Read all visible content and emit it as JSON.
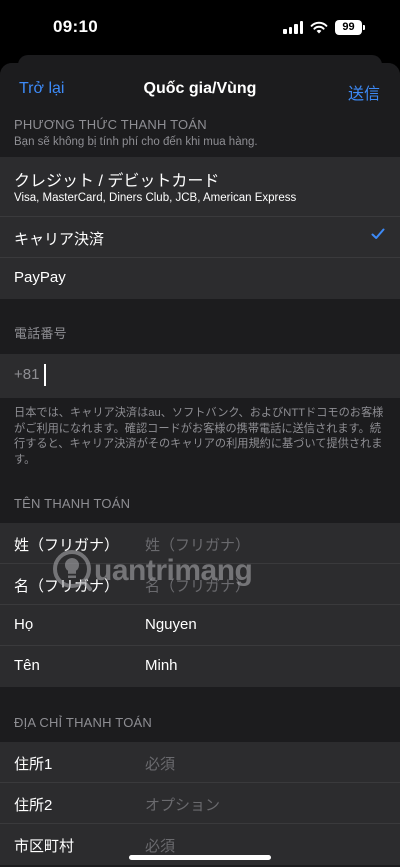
{
  "status": {
    "time": "09:10",
    "battery": "99"
  },
  "nav": {
    "back": "Trở lại",
    "title": "Quốc gia/Vùng",
    "send": "送信"
  },
  "payment": {
    "header": "PHƯƠNG THỨC THANH TOÁN",
    "sub": "Bạn sẽ không bị tính phí cho đến khi mua hàng.",
    "card": {
      "title": "クレジット / デビットカード",
      "sub": "Visa, MasterCard, Diners Club, JCB, American Express"
    },
    "carrier": "キャリア決済",
    "paypay": "PayPay"
  },
  "phone": {
    "header": "電話番号",
    "prefix": "+81",
    "note": "日本では、キャリア決済はau、ソフトバンク、およびNTTドコモのお客様がご利用になれます。確認コードがお客様の携帯電話に送信されます。続行すると、キャリア決済がそのキャリアの利用規約に基づいて提供されます。"
  },
  "billing_name": {
    "header": "TÊN THANH TOÁN",
    "fields": [
      {
        "label": "姓（フリガナ）",
        "value": "",
        "placeholder": "姓（フリガナ）"
      },
      {
        "label": "名（フリガナ）",
        "value": "",
        "placeholder": "名（フリガナ）"
      },
      {
        "label": "Họ",
        "value": "Nguyen",
        "placeholder": ""
      },
      {
        "label": "Tên",
        "value": "Minh",
        "placeholder": ""
      }
    ]
  },
  "billing_address": {
    "header": "ĐỊA CHỈ THANH TOÁN",
    "fields": [
      {
        "label": "住所1",
        "value": "",
        "placeholder": "必須"
      },
      {
        "label": "住所2",
        "value": "",
        "placeholder": "オプション"
      },
      {
        "label": "市区町村",
        "value": "",
        "placeholder": "必須"
      }
    ]
  },
  "watermark": "uantrimang",
  "colors": {
    "accent": "#3d8af7",
    "background": "#1c1c1e",
    "cell": "#2c2c2e",
    "secondary_text": "#8e8e93"
  }
}
